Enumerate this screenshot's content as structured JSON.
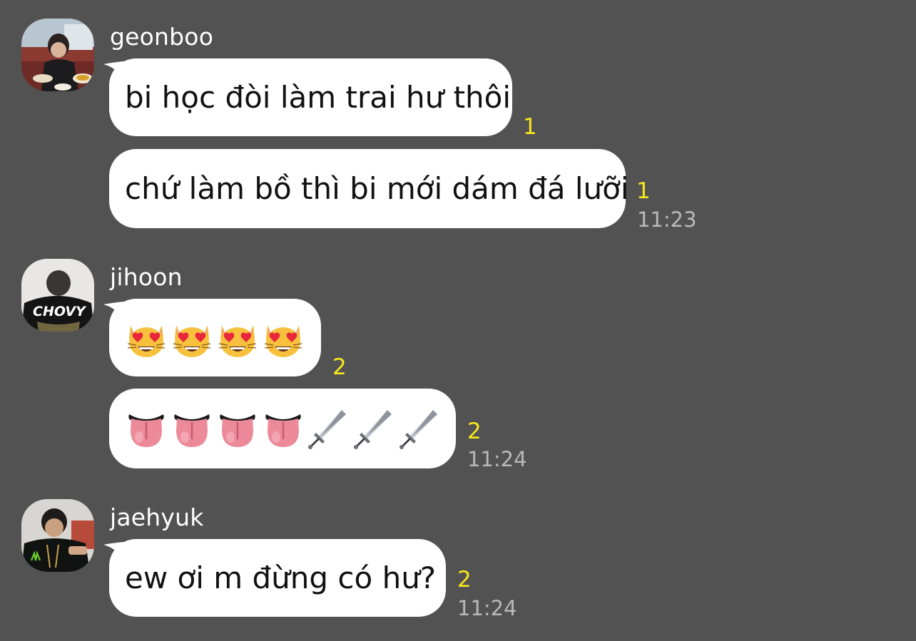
{
  "messages": [
    {
      "sender": "geonboo",
      "bubbles": [
        {
          "text": "bi học đòi làm trai hư thôi",
          "unread": "1"
        },
        {
          "text": "chứ làm bồ thì bi mới dám đá lưỡi",
          "unread": "1",
          "time": "11:23"
        }
      ]
    },
    {
      "sender": "jihoon",
      "bubbles": [
        {
          "emojis": [
            "heart-eyes-cat",
            "heart-eyes-cat",
            "heart-eyes-cat",
            "heart-eyes-cat"
          ],
          "unread": "2"
        },
        {
          "emojis": [
            "tongue",
            "tongue",
            "tongue",
            "tongue",
            "dagger",
            "dagger",
            "dagger"
          ],
          "unread": "2",
          "time": "11:24"
        }
      ]
    },
    {
      "sender": "jaehyuk",
      "bubbles": [
        {
          "text": "ew ơi m đừng có hư?",
          "unread": "2",
          "time": "11:24"
        }
      ]
    }
  ],
  "colors": {
    "background": "#535253",
    "bubble": "#ffffff",
    "unread": "#f8e71c",
    "time": "#b9b9ba"
  }
}
